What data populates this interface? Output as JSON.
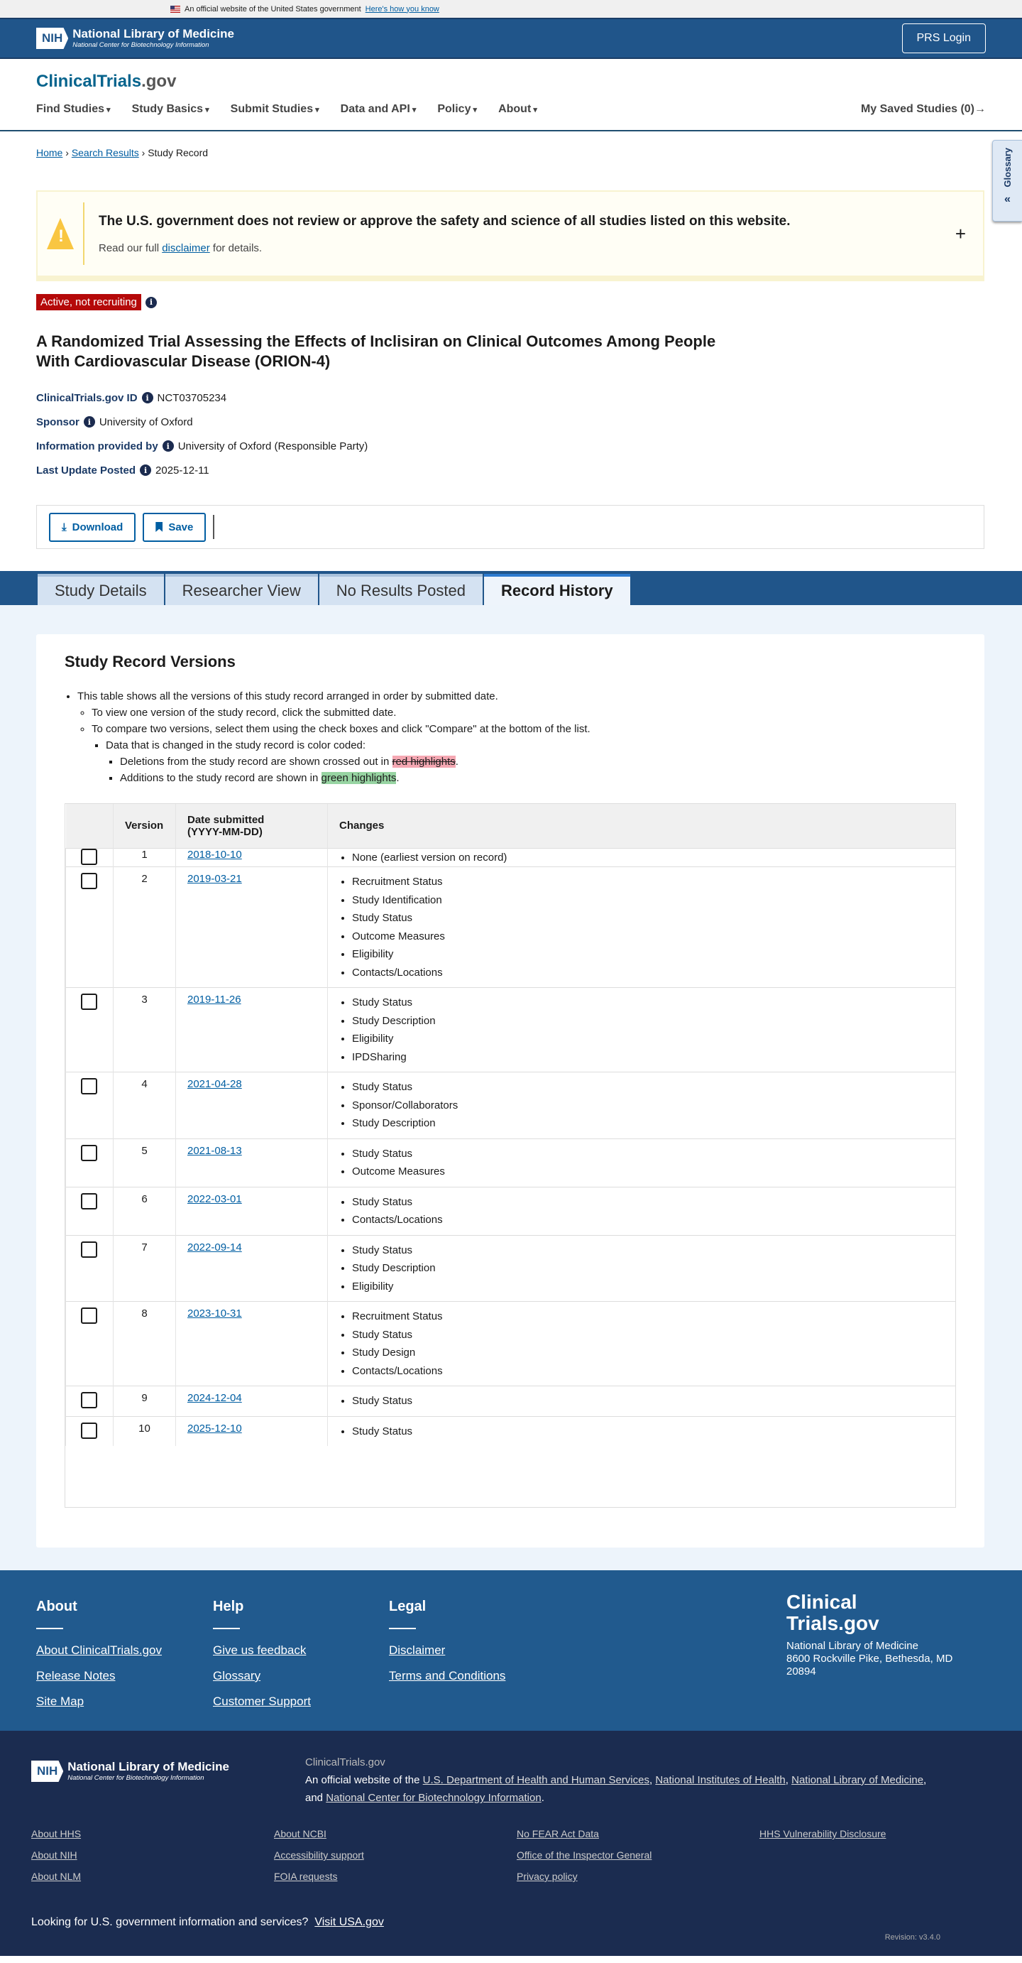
{
  "gov_banner": {
    "text": "An official website of the United States government",
    "link": "Here's how you know"
  },
  "header": {
    "nih_abbr": "NIH",
    "nih_title": "National Library of Medicine",
    "nih_sub": "National Center for Biotechnology Information",
    "prs_login": "PRS Login"
  },
  "site": {
    "logo_main": "ClinicalTrials",
    "logo_suffix": ".gov",
    "nav": [
      "Find Studies",
      "Study Basics",
      "Submit Studies",
      "Data and API",
      "Policy",
      "About"
    ],
    "saved": "My Saved Studies (0)→",
    "glossary": "Glossary"
  },
  "breadcrumb": {
    "home": "Home",
    "search": "Search Results",
    "current": "Study Record"
  },
  "alert": {
    "title": "The U.S. government does not review or approve the safety and science of all studies listed on this website.",
    "pre": "Read our full ",
    "link": "disclaimer",
    "post": " for details."
  },
  "study": {
    "status": "Active, not recruiting",
    "title": "A Randomized Trial Assessing the Effects of Inclisiran on Clinical Outcomes Among People With Cardiovascular Disease (ORION-4)",
    "meta": [
      {
        "label": "ClinicalTrials.gov ID",
        "value": "NCT03705234"
      },
      {
        "label": "Sponsor",
        "value": "University of Oxford"
      },
      {
        "label": "Information provided by",
        "value": "University of Oxford (Responsible Party)"
      },
      {
        "label": "Last Update Posted",
        "value": "2025-12-11"
      }
    ]
  },
  "actions": {
    "download": "Download",
    "save": "Save"
  },
  "tabs": [
    "Study Details",
    "Researcher View",
    "No Results Posted",
    "Record History"
  ],
  "versions": {
    "heading": "Study Record Versions",
    "intro": "This table shows all the versions of this study record arranged in order by submitted date.",
    "view": "To view one version of the study record, click the submitted date.",
    "compare": "To compare two versions, select them using the check boxes and click \"Compare\" at the bottom of the list.",
    "coded": "Data that is changed in the study record is color coded:",
    "del_pre": "Deletions from the study record are shown crossed out in ",
    "del_hl": "red highlights",
    "add_pre": "Additions to the study record are shown in ",
    "add_hl": "green highlights",
    "period": ".",
    "columns": {
      "version": "Version",
      "date1": "Date submitted",
      "date2": "(YYYY-MM-DD)",
      "changes": "Changes"
    },
    "rows": [
      {
        "version": "1",
        "date": "2018-10-10",
        "changes": [
          "None (earliest version on record)"
        ]
      },
      {
        "version": "2",
        "date": "2019-03-21",
        "changes": [
          "Recruitment Status",
          "Study Identification",
          "Study Status",
          "Outcome Measures",
          "Eligibility",
          "Contacts/Locations"
        ]
      },
      {
        "version": "3",
        "date": "2019-11-26",
        "changes": [
          "Study Status",
          "Study Description",
          "Eligibility",
          "IPDSharing"
        ]
      },
      {
        "version": "4",
        "date": "2021-04-28",
        "changes": [
          "Study Status",
          "Sponsor/Collaborators",
          "Study Description"
        ]
      },
      {
        "version": "5",
        "date": "2021-08-13",
        "changes": [
          "Study Status",
          "Outcome Measures"
        ]
      },
      {
        "version": "6",
        "date": "2022-03-01",
        "changes": [
          "Study Status",
          "Contacts/Locations"
        ]
      },
      {
        "version": "7",
        "date": "2022-09-14",
        "changes": [
          "Study Status",
          "Study Description",
          "Eligibility"
        ]
      },
      {
        "version": "8",
        "date": "2023-10-31",
        "changes": [
          "Recruitment Status",
          "Study Status",
          "Study Design",
          "Contacts/Locations"
        ]
      },
      {
        "version": "9",
        "date": "2024-12-04",
        "changes": [
          "Study Status"
        ]
      },
      {
        "version": "10",
        "date": "2025-12-10",
        "changes": [
          "Study Status"
        ]
      }
    ]
  },
  "footer": {
    "cols": [
      {
        "title": "About",
        "links": [
          "About ClinicalTrials.gov",
          "Release Notes",
          "Site Map"
        ]
      },
      {
        "title": "Help",
        "links": [
          "Give us feedback",
          "Glossary",
          "Customer Support"
        ]
      },
      {
        "title": "Legal",
        "links": [
          "Disclaimer",
          "Terms and Conditions"
        ]
      }
    ],
    "logo1": "Clinical",
    "logo2": "Trials.gov",
    "address1": "National Library of Medicine",
    "address2": "8600 Rockville Pike, Bethesda, MD",
    "address3": "20894",
    "site": "ClinicalTrials.gov",
    "official_pre": "An official website of the ",
    "hhs": "U.S. Department of Health and Human Services",
    "nih": "National Institutes of Health",
    "nlm": "National Library of Medicine",
    "and": "and ",
    "ncbi": "National Center for Biotechnology Information",
    "links": [
      "About HHS",
      "About NCBI",
      "No FEAR Act Data",
      "HHS Vulnerability Disclosure",
      "About NIH",
      "Accessibility support",
      "Office of the Inspector General",
      "",
      "About NLM",
      "FOIA requests",
      "Privacy policy",
      ""
    ],
    "usa_pre": "Looking for U.S. government information and services?",
    "usa_link": "Visit USA.gov",
    "revision": "Revision: v3.4.0"
  }
}
